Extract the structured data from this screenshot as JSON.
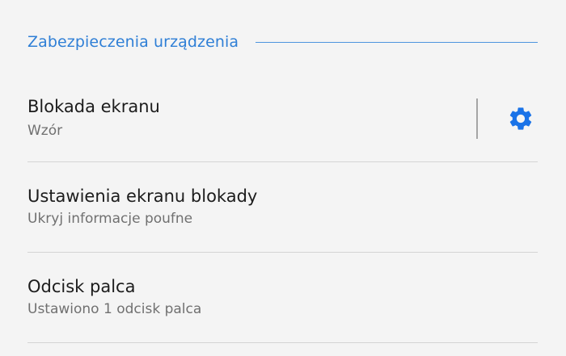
{
  "section": {
    "title": "Zabezpieczenia urządzenia"
  },
  "items": [
    {
      "title": "Blokada ekranu",
      "subtitle": "Wzór",
      "icon": "gear-icon"
    },
    {
      "title": "Ustawienia ekranu blokady",
      "subtitle": "Ukryj informacje poufne"
    },
    {
      "title": "Odcisk palca",
      "subtitle": "Ustawiono 1 odcisk palca"
    }
  ],
  "colors": {
    "accent": "#2f7fd6",
    "background": "#f4f4f4",
    "divider": "#d4d4d4",
    "primary_text": "#1c1c1c",
    "secondary_text": "#707070"
  }
}
